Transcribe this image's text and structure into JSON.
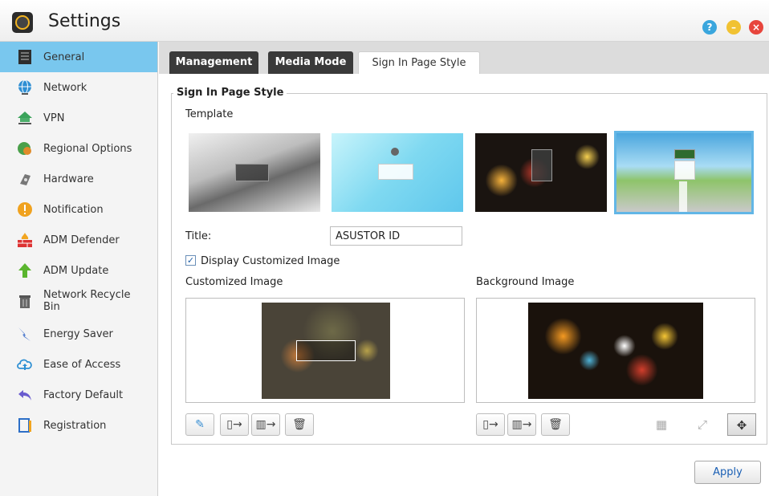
{
  "window": {
    "title": "Settings",
    "help_icon": "question-icon",
    "minimize_icon": "minimize-icon",
    "close_icon": "close-icon"
  },
  "sidebar": {
    "items": [
      {
        "label": "General",
        "icon": "general-icon",
        "active": true
      },
      {
        "label": "Network",
        "icon": "globe-icon"
      },
      {
        "label": "VPN",
        "icon": "vpn-icon"
      },
      {
        "label": "Regional Options",
        "icon": "regional-icon"
      },
      {
        "label": "Hardware",
        "icon": "hardware-icon"
      },
      {
        "label": "Notification",
        "icon": "notification-icon"
      },
      {
        "label": "ADM Defender",
        "icon": "firewall-icon"
      },
      {
        "label": "ADM Update",
        "icon": "update-arrow-icon"
      },
      {
        "label": "Network Recycle Bin",
        "icon": "recycle-bin-icon"
      },
      {
        "label": "Energy Saver",
        "icon": "energy-icon"
      },
      {
        "label": "Ease of Access",
        "icon": "cloud-icon"
      },
      {
        "label": "Factory Default",
        "icon": "reset-arrow-icon"
      },
      {
        "label": "Registration",
        "icon": "registration-icon"
      }
    ]
  },
  "tabs": [
    {
      "label": "Management",
      "active": false
    },
    {
      "label": "Media Mode",
      "active": false
    },
    {
      "label": "Sign In Page Style",
      "active": true
    }
  ],
  "section": {
    "legend": "Sign In Page Style",
    "template_label": "Template",
    "selected_template": 4,
    "title_label": "Title:",
    "title_value": "ASUSTOR ID",
    "display_customized_label": "Display Customized Image",
    "display_customized_checked": true,
    "customized_image_label": "Customized Image",
    "background_image_label": "Background Image"
  },
  "toolbar": {
    "custom_buttons": [
      "edit-icon",
      "import-file-icon",
      "import-folder-icon",
      "trash-icon"
    ],
    "background_buttons": [
      "import-file-icon",
      "import-folder-icon",
      "trash-icon"
    ],
    "view_modes": [
      "tile-icon",
      "stretch-icon",
      "fit-icon"
    ],
    "selected_view_mode": "fit-icon"
  },
  "apply_label": "Apply",
  "colors": {
    "active_sidebar": "#79c7ee",
    "dark_tab": "#3a3a3a",
    "apply_text": "#1a5fb4",
    "selected_outline": "#62b6e6"
  }
}
